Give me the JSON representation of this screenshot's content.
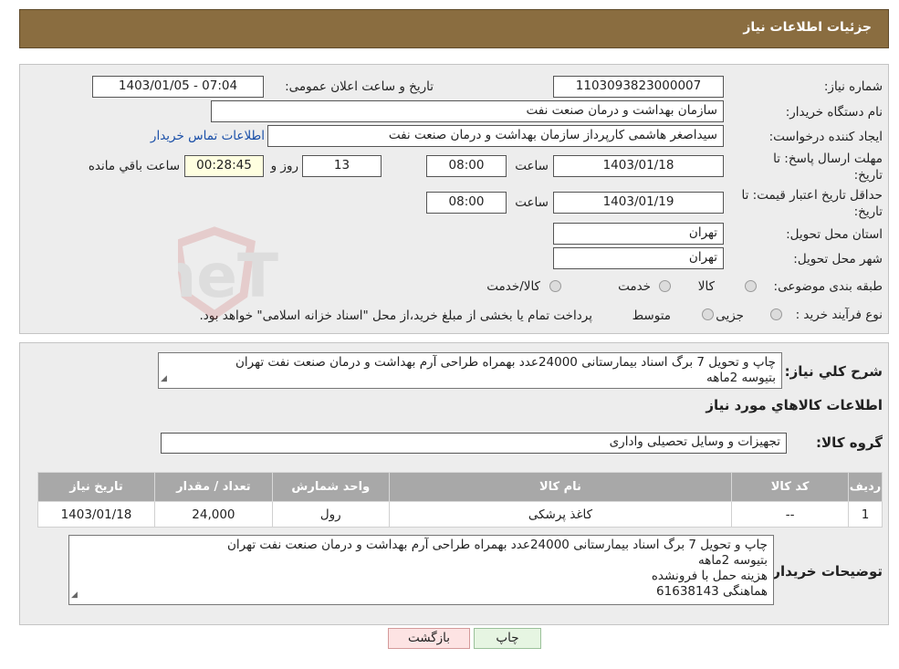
{
  "header": {
    "title": "جزئیات اطلاعات نیاز"
  },
  "form": {
    "need_number_label": "شماره نیاز:",
    "need_number": "1103093823000007",
    "announce_label": "تاریخ و ساعت اعلان عمومی:",
    "announce_value": "1403/01/05 - 07:04",
    "buyer_org_label": "نام دستگاه خریدار:",
    "buyer_org": "سازمان بهداشت و درمان صنعت نفت",
    "creator_label": "ایجاد کننده درخواست:",
    "creator": "سیداصغر هاشمی کارپرداز سازمان بهداشت و درمان صنعت نفت",
    "contact_link": "اطلاعات تماس خریدار",
    "deadline_label_1": "مهلت ارسال پاسخ: تا",
    "deadline_label_2": "تاریخ:",
    "deadline_date": "1403/01/18",
    "time_label": "ساعت",
    "deadline_time": "08:00",
    "days_value": "13",
    "days_label": "روز و",
    "remaining_time": "00:28:45",
    "remaining_label": "ساعت باقي مانده",
    "validity_label_1": "حداقل تاریخ اعتبار قیمت: تا",
    "validity_label_2": "تاریخ:",
    "validity_date": "1403/01/19",
    "validity_time": "08:00",
    "province_label": "استان محل تحویل:",
    "province": "تهران",
    "city_label": "شهر محل تحویل:",
    "city": "تهران",
    "category_label": "طبقه بندی موضوعی:",
    "category_options": [
      "کالا",
      "خدمت",
      "کالا/خدمت"
    ],
    "process_label": "نوع فرآیند خرید :",
    "process_options": [
      "جزیی",
      "متوسط"
    ],
    "process_note": "پرداخت تمام یا بخشی از مبلغ خرید،از محل \"اسناد خزانه اسلامی\" خواهد بود."
  },
  "details": {
    "summary_label": "شرح کلي نياز:",
    "summary_lines": [
      "چاپ و تحویل 7 برگ اسناد بیمارستانی 24000عدد بهمراه طراحی آرم بهداشت و درمان صنعت نفت تهران",
      "بتیوسه 2ماهه"
    ],
    "goods_heading": "اطلاعات کالاهاي مورد نياز",
    "goods_group_label": "گروه کالا:",
    "goods_group": "تجهیزات و وسایل تحصیلی واداری",
    "table": {
      "headers": [
        "ردیف",
        "کد کالا",
        "نام کالا",
        "واحد شمارش",
        "تعداد / مقدار",
        "تاریخ نیاز"
      ],
      "rows": [
        [
          "1",
          "--",
          "کاغذ پرشکی",
          "رول",
          "24,000",
          "1403/01/18"
        ]
      ]
    },
    "buyer_notes_label": "توضیحات خریدار:",
    "buyer_notes_lines": [
      "چاپ و تحویل 7 برگ اسناد بیمارستانی 24000عدد بهمراه طراحی آرم بهداشت و درمان صنعت نفت تهران",
      "بتیوسه 2ماهه",
      "هزینه حمل با فرونشده",
      "هماهنگی 61638143"
    ]
  },
  "buttons": {
    "print": "چاپ",
    "back": "بازگشت"
  },
  "watermark": {
    "text": "AriaTender.neT"
  },
  "colors": {
    "title_bg": "#8a6d40",
    "panel_bg": "#ededed",
    "table_header": "#a8a8a8",
    "link": "#1a4fa8"
  }
}
